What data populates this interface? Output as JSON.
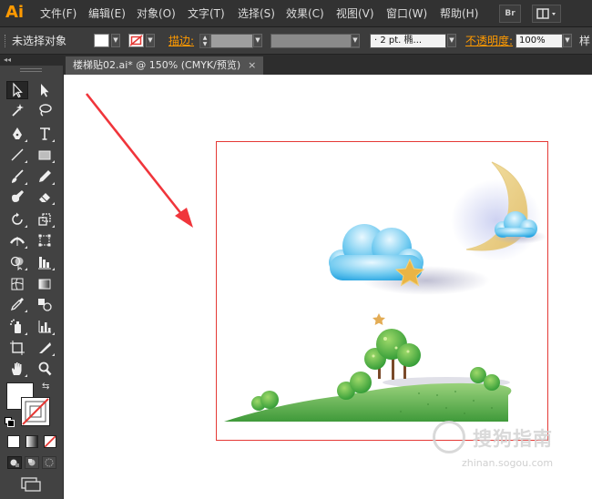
{
  "app": {
    "logo": "Ai",
    "bridge_label": "Br"
  },
  "colors": {
    "accent": "#ff9a00",
    "artboard_border": "#e53935",
    "arrow": "#f0353b"
  },
  "menu": [
    {
      "id": "file",
      "label": "文件(F)"
    },
    {
      "id": "edit",
      "label": "编辑(E)"
    },
    {
      "id": "object",
      "label": "对象(O)"
    },
    {
      "id": "type",
      "label": "文字(T)"
    },
    {
      "id": "select",
      "label": "选择(S)"
    },
    {
      "id": "effect",
      "label": "效果(C)"
    },
    {
      "id": "view",
      "label": "视图(V)"
    },
    {
      "id": "window",
      "label": "窗口(W)"
    },
    {
      "id": "help",
      "label": "帮助(H)"
    }
  ],
  "control": {
    "no_selection": "未选择对象",
    "stroke_label": "描边:",
    "brush_value": "· 2 pt. 椭...",
    "opacity_label": "不透明度:",
    "opacity_value": "100%",
    "style_label": "样"
  },
  "document": {
    "tab_title": "楼梯贴02.ai* @ 150% (CMYK/预览)",
    "close": "×"
  },
  "toolpanel": {
    "collapse": "◂◂"
  },
  "icons": {
    "bridge": "br-icon",
    "workspace": "workspace-switcher-icon",
    "fill": "fill-swatch-icon",
    "stroke": "stroke-swatch-icon",
    "swap": "swap-fill-stroke-icon",
    "default": "default-colors-icon"
  },
  "watermark": {
    "brand": "搜狗指南",
    "url": "zhinan.sogou.com"
  }
}
